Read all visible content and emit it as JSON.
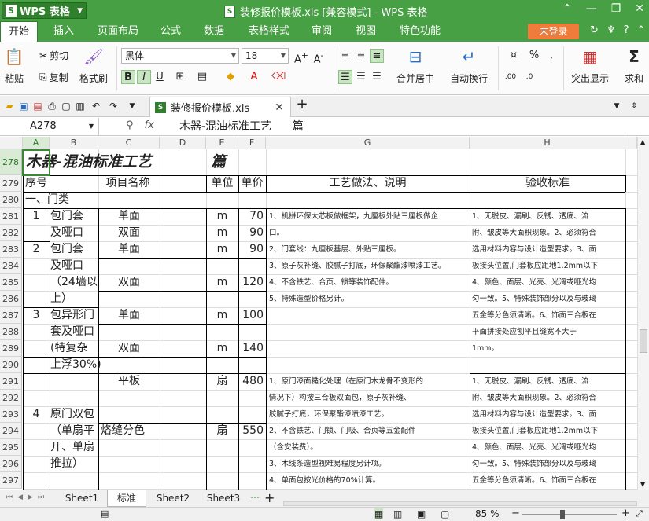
{
  "app": {
    "name": "WPS 表格",
    "window_title": "装修报价模板.xls [兼容模式] - WPS 表格"
  },
  "menu": {
    "items": [
      "开始",
      "插入",
      "页面布局",
      "公式",
      "数据",
      "表格样式",
      "审阅",
      "视图",
      "特色功能"
    ],
    "login": "未登录"
  },
  "ribbon": {
    "paste": "粘贴",
    "cut": "剪切",
    "copy": "复制",
    "format_painter": "格式刷",
    "font_name": "黑体",
    "font_size": "18",
    "merge_center": "合并居中",
    "wrap_text": "自动换行",
    "highlight": "突出显示",
    "sum": "求和"
  },
  "doc_tab": {
    "name": "装修报价模板.xls"
  },
  "formula_bar": {
    "cell_ref": "A278",
    "content": "木器-混油标准工艺      篇"
  },
  "columns": [
    "A",
    "B",
    "C",
    "D",
    "E",
    "F",
    "G",
    "H"
  ],
  "rows": [
    "278",
    "279",
    "280",
    "281",
    "282",
    "283",
    "284",
    "285",
    "286",
    "287",
    "288",
    "289",
    "290",
    "291",
    "292",
    "293",
    "294",
    "295",
    "296",
    "297"
  ],
  "sheet": {
    "title": "木器-混油标准工艺",
    "title_suffix": "篇",
    "headers": {
      "no": "序号",
      "name": "项目名称",
      "unit": "单位",
      "price": "单价",
      "process": "工艺做法、说明",
      "accept": "验收标准"
    },
    "section": "一、门类",
    "no1": "1",
    "no2": "2",
    "no3": "3",
    "no4": "4",
    "name_281": "包门套",
    "name_282": "及哑口",
    "name_283": "包门套",
    "name_284": "及哑口",
    "name_285": "（24墙以",
    "name_286": "上）",
    "name_287": "包异形门",
    "name_288": "套及哑口",
    "name_289": "(特复杂",
    "name_290": "上浮30%)",
    "name_293": "原门双包",
    "name_294": "（单扇平",
    "name_295": "开、单扇",
    "name_296": "推拉）",
    "c_281": "单面",
    "c_282": "双面",
    "c_283": "单面",
    "c_285": "双面",
    "c_287": "单面",
    "c_289": "双面",
    "c_291": "平板",
    "c_294": "烙缝分色",
    "u_281": "m",
    "u_282": "m",
    "u_283": "m",
    "u_285": "m",
    "u_287": "m",
    "u_289": "m",
    "u_291": "扇",
    "u_294": "扇",
    "p_281": "70",
    "p_282": "90",
    "p_283": "90",
    "p_285": "120",
    "p_287": "100",
    "p_289": "140",
    "p_291": "480",
    "p_294": "550",
    "g_281": "1、机拼环保大芯板做框架，九厘板外贴三厘板做企",
    "g_282": "口。",
    "g_283": "2、门套线：九厘板基层、外贴三厘板。",
    "g_284": "3、原子灰补缝、胶腻子打底，环保聚酯漆喷漆工艺。",
    "g_285": "4、不含铁艺、合页、锁等装饰配件。",
    "g_286": "5、特殊造型价格另计。",
    "h_281": "1、无脱皮、漏刷、反锈、透底、流",
    "h_282": "附、皱皮等大面积现象。2、必须符合",
    "h_283": "选用材料内容与设计造型要求。3、面",
    "h_284": "板接头位置,门套板应距地1.2mm以下",
    "h_285": "4、颜色、面层、光亮、光滑或哑光均",
    "h_286": "匀一致。5、特殊装饰部分以及与玻璃",
    "h_287": "五金等分色须清晰。6、饰面三合板在",
    "h_288": "平面拼接处应刨平且缝宽不大于",
    "h_289": "1mm。",
    "g_291": "1、原门漆面糙化处理（在原门木龙骨不变形的",
    "g_292": "情况下）构按三合板双面包，原子灰补缝、",
    "g_293": "胶腻子打底，环保聚酯漆喷漆工艺。",
    "g_294": "2、不含铁艺、门锁、门吸、合页等五金配件",
    "g_295": "（含安装费）。",
    "g_296": "3、木线条造型视难易程度另计项。",
    "g_297": "4、单面包按光价格的70%计算。",
    "h_291": "1、无脱皮、漏刷、反锈、透底、流",
    "h_292": "附、皱皮等大面积现象。2、必须符合",
    "h_293": "选用材料内容与设计造型要求。3、面",
    "h_294": "板接头位置,门套板应距地1.2mm以下",
    "h_295": "4、颜色、面层、光亮、光滑或哑光均",
    "h_296": "匀一致。5、特殊装饰部分以及与玻璃",
    "h_297": "五金等分色须清晰。6、饰面三合板在"
  },
  "sheets": [
    "Sheet1",
    "标准",
    "Sheet2",
    "Sheet3"
  ],
  "status": {
    "zoom": "85 %"
  },
  "colors": {
    "brand_green": "#47a043",
    "login_orange": "#f07c3c"
  }
}
